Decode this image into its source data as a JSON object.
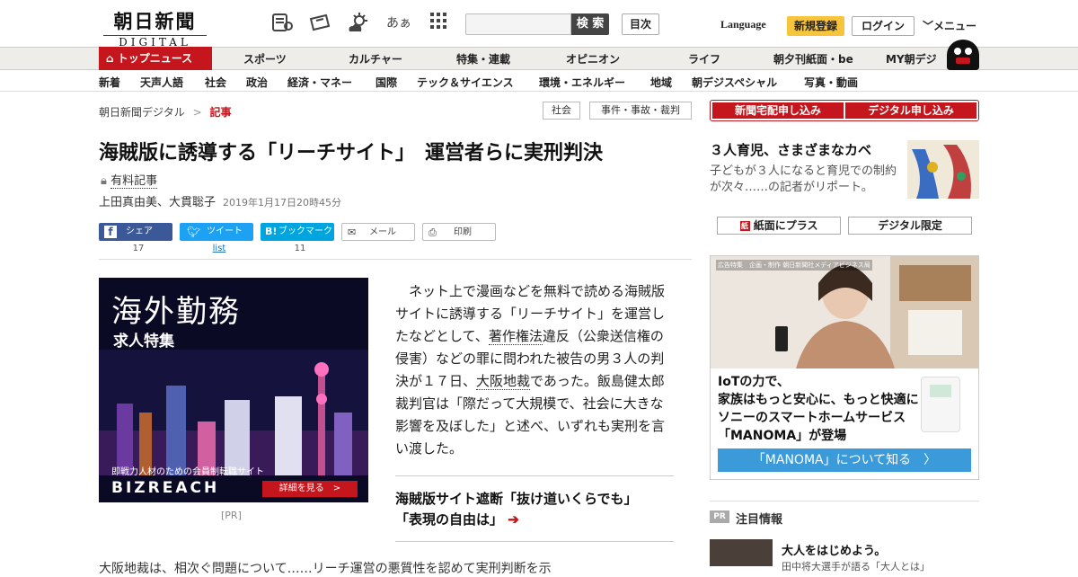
{
  "header": {
    "logo_jp": "朝日新聞",
    "logo_en": "DIGITAL",
    "search_button": "検 索",
    "toc_button": "目次",
    "language": "Language",
    "register": "新規登録",
    "login": "ログイン",
    "menu": "メニュー",
    "icon_kana": "あぁ"
  },
  "nav_primary": [
    "トップニュース",
    "スポーツ",
    "カルチャー",
    "特集・連載",
    "オピニオン",
    "ライフ",
    "朝夕刊紙面・be",
    "MY朝デジ"
  ],
  "nav_secondary": [
    "新着",
    "天声人語",
    "社会",
    "政治",
    "経済・マネー",
    "国際",
    "テック＆サイエンス",
    "環境・エネルギー",
    "地域",
    "朝デジスペシャル",
    "写真・動画"
  ],
  "breadcrumb": {
    "home": "朝日新聞デジタル",
    "sep": ">",
    "current": "記事"
  },
  "tags": [
    "社会",
    "事件・事故・裁判"
  ],
  "cta": {
    "delivery": "新聞宅配申し込み",
    "digital": "デジタル申し込み"
  },
  "article": {
    "headline": "海賊版に誘導する「リーチサイト」　運営者らに実刑判決",
    "paid_label": "有料記事",
    "authors": "上田真由美、大貫聡子",
    "date": "2019年1月17日20時45分",
    "body_parts": [
      "ネット上で漫画などを無料で読める海賊版サイトに誘導する「リーチサイト」を運営したなどとして、",
      "著作権法",
      "違反（公衆送信権の侵害）などの罪に問われた被告の男３人の判決が１７日、",
      "大阪地裁",
      "であった。飯島健太郎裁判官は「際だって大規模で、社会に大きな影響を及ぼした」と述べ、いずれも実刑を言い渡した。"
    ],
    "related_line1": "海賊版サイト遮断「抜け道いくらでも」",
    "related_line2": "「表現の自由は」",
    "bottom_text": "大阪地裁は、相次ぐ問題について……リーチ運営の悪質性を認めて実刑判断を示"
  },
  "share": {
    "facebook": "シェア",
    "facebook_count": "17",
    "twitter": "ツイート",
    "twitter_count": "list",
    "hatena": "ブックマーク",
    "hatena_count": "11",
    "mail": "メール",
    "print": "印刷"
  },
  "ad_left": {
    "title": "海外勤務",
    "subtitle": "求人特集",
    "caption": "即戦力人材のための会員制転職サイト",
    "brand": "BIZREACH",
    "button": "詳細を見る　>",
    "pr": "[PR]"
  },
  "sidebar": {
    "feature_title": "３人育児、さまざまなカベ",
    "feature_desc": "子どもが３人になると育児での制約が次々……の記者がリポート。",
    "btn_paper": "紙面にプラス",
    "btn_digital": "デジタル限定",
    "ad_header": "広告特集　企画・制作 朝日新聞社メディアビジネス局",
    "ad_copy": [
      "IoTの力で、",
      "家族はもっと安心に、もっと快適に",
      "ソニーのスマートホームサービス",
      "「MANOMA」が登場"
    ],
    "ad_cta": "「MANOMA」について知る　〉",
    "pr_badge": "PR",
    "attention": "注目情報",
    "pr_title": "大人をはじめよう。",
    "pr_sub": "田中将大選手が語る「大人とは」"
  },
  "colors": {
    "brand_red": "#c4161c",
    "facebook": "#3b5998",
    "twitter": "#1da1f2",
    "hatena": "#00a4de",
    "register": "#f6c53c"
  }
}
